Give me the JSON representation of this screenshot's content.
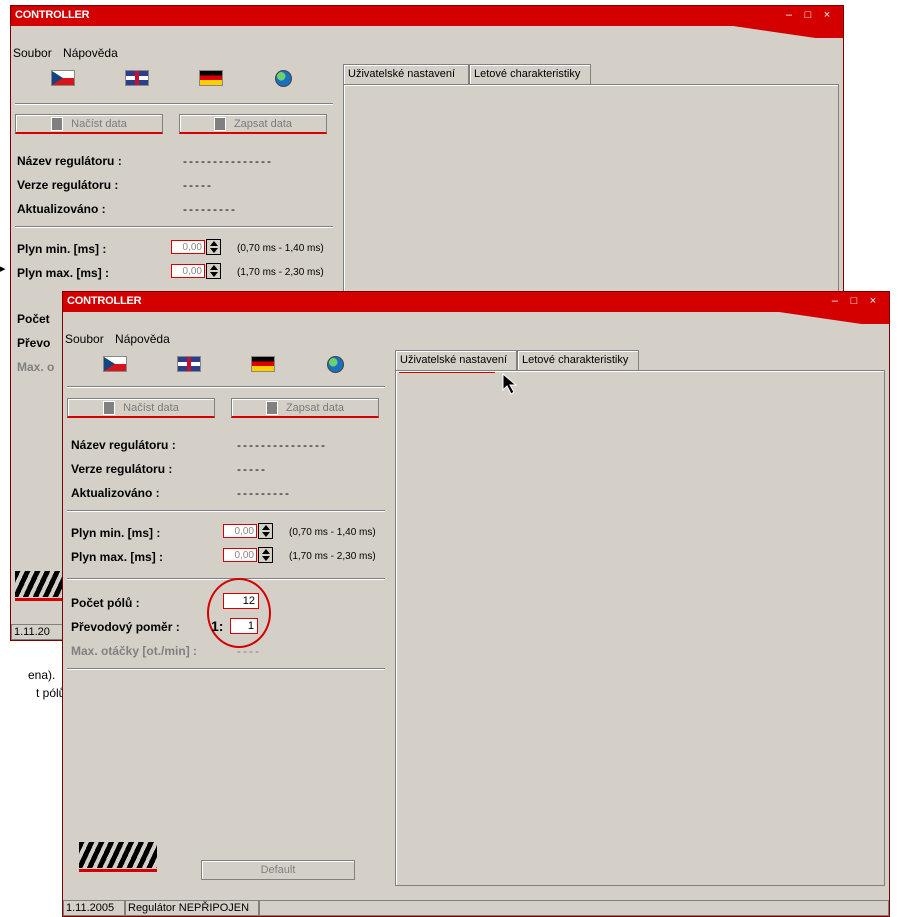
{
  "window": {
    "title": "CONTROLLER",
    "controls": [
      "–",
      "□",
      "×"
    ]
  },
  "menu": [
    "Soubor",
    "Nápověda"
  ],
  "flags": [
    "czech-flag-icon",
    "uk-flag-icon",
    "german-flag-icon",
    "globe-icon"
  ],
  "buttons": {
    "load": "Načíst data",
    "write": "Zapsat data",
    "default": "Default"
  },
  "info": {
    "name_label": "Název regulátoru :",
    "name_value": "---------------",
    "version_label": "Verze regulátoru :",
    "version_value": "-----",
    "updated_label": "Aktualizováno :",
    "updated_value": "---------"
  },
  "throttle": {
    "min_label": "Plyn min. [ms] :",
    "min_value": "0,00",
    "min_range": "(0,70 ms - 1,40 ms)",
    "max_label": "Plyn max. [ms] :",
    "max_value": "0,00",
    "max_range": "(1,70 ms - 2,30 ms)"
  },
  "motor": {
    "poles_label": "Počet pólů :",
    "poles_value": "12",
    "ratio_label": "Převodový poměr :",
    "ratio_prefix": "1:",
    "ratio_value": "1",
    "rpm_label": "Max. otáčky [ot./min] :",
    "rpm_value": "----"
  },
  "tabs": [
    "Uživatelské nastavení",
    "Letové charakteristiky"
  ],
  "status": {
    "date": "1.11.2005",
    "connection": "Regulátor NEPŘIPOJEN"
  },
  "background": {
    "back_win_partial_labels": [
      "Počet",
      "Převo",
      "Max. o"
    ],
    "back_status_partial": "1.11.20",
    "page_text_1": "ena).",
    "page_text_2": "t pólů"
  },
  "colors": {
    "accent": "#d40000",
    "face": "#d4d0c8"
  }
}
